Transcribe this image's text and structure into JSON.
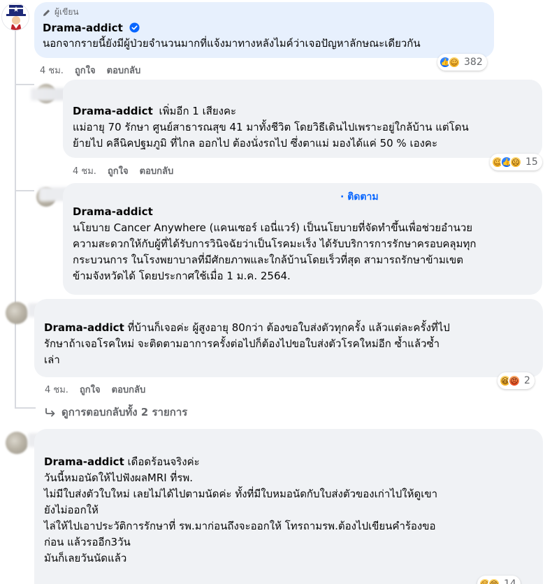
{
  "comment1": {
    "author_badge": "ผู้เขียน",
    "author": "Drama-addict",
    "text": "นอกจากรายนี้ยังมีผู้ป่วยจำนวนมากที่แจ้งมาทางหลังไมค์ว่าเจอปัญหาลักษณะเดียวกัน",
    "time": "4 ชม.",
    "like_label": "ถูกใจ",
    "reply_label": "ตอบกลับ",
    "reaction_count": "382",
    "reactions": [
      "like-icon",
      "care-icon"
    ]
  },
  "reply1": {
    "mention": "Drama-addict",
    "lines": [
      "เพิ่มอีก 1 เสียงคะ",
      "แม่อายุ 70 รักษา ศูนย์สาธารณสุข 41 มาทั้งชีวิต โดยวิธีเดินไปเพราะอยู่ใกล้บ้าน แต่โดน",
      "ย้ายไป คลีนิคปฐมภูมิ ที่ไกล ออกไป ต้องนั่งรถไป ซึ่งตาแม่ มองได้แค่ 50 % เองคะ"
    ],
    "time": "4 ชม.",
    "like_label": "ถูกใจ",
    "reply_label": "ตอบกลับ",
    "reaction_count": "15",
    "reactions": [
      "care-icon",
      "like-icon",
      "sad-icon"
    ]
  },
  "reply2": {
    "follow_label": "· ติดตาม",
    "mention": "Drama-addict",
    "lines": [
      "นโยบาย Cancer Anywhere (แคนเซอร์ เอนี่แวร์) เป็นนโยบายที่จัดทำขึ้นเพื่อช่วยอำนวย",
      "ความสะดวกให้กับผู้ที่ได้รับการวินิจฉัยว่าเป็นโรคมะเร็ง ได้รับบริการการรักษาครอบคลุมทุก",
      "กระบวนการ ในโรงพยาบาลที่มีศักยภาพและใกล้บ้านโดยเร็วที่สุด สามารถรักษาข้ามเขต",
      "ข้ามจังหวัดได้ โดยประกาศใช้เมื่อ 1 ม.ค. 2564."
    ]
  },
  "comment2": {
    "mention": "Drama-addict",
    "lines": [
      " ที่บ้านก็เจอค่ะ ผู้สูงอายุ 80กว่า ต้องขอใบส่งตัวทุกครั้ง แล้วแต่ละครั้งที่ไป",
      "รักษาถ้าเจอโรคใหม่ จะติดตามอาการครั้งต่อไปก็ต้องไปขอใบส่งตัวโรคใหม่อีก ซ้ำแล้วซ้ำ",
      "เล่า"
    ],
    "time": "4 ชม.",
    "like_label": "ถูกใจ",
    "reply_label": "ตอบกลับ",
    "reaction_count": "2",
    "reactions": [
      "haha-icon",
      "angry-icon"
    ],
    "view_replies": "ดูการตอบกลับทั้ง 2 รายการ"
  },
  "comment3": {
    "mention": "Drama-addict",
    "lines": [
      " เดือดร้อนจริงค่ะ",
      "วันนี้หมอนัดให้ไปฟังผลMRI ที่รพ.",
      "ไม่มีใบส่งตัวใบใหม่ เลยไม่ได้ไปตามนัดค่ะ ทั้งที่มีใบหมอนัดกับใบส่งตัวของเก่าไปให้ดูเขา",
      "ยังไม่ออกให้",
      "ไล่ให้ไปเอาประวัติการรักษาที่ รพ.มาก่อนถึงจะออกให้ โทรถามรพ.ต้องไปเขียนคำร้องขอ",
      "ก่อน แล้วรออีก3วัน",
      "มันก็เลยวันนัดแล้ว"
    ],
    "reaction_count": "14",
    "reactions": [
      "care-icon",
      "haha-icon"
    ]
  },
  "colors": {
    "author_bubble": "#e7f0fd",
    "bubble": "#f0f2f5",
    "link_blue": "#0866ff",
    "meta_gray": "#65676b"
  }
}
